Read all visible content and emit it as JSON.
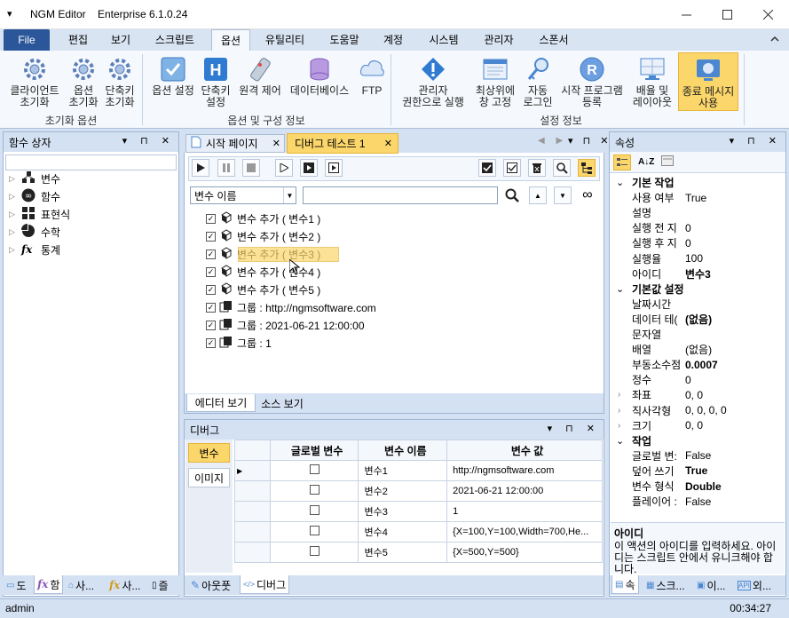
{
  "window": {
    "app_name": "NGM Editor",
    "edition": "Enterprise 6.1.0.24",
    "menu_glyph": "▾"
  },
  "menu": [
    "File",
    "편집",
    "보기",
    "스크립트",
    "옵션",
    "유틸리티",
    "도움말",
    "계정",
    "시스템",
    "관리자",
    "스폰서"
  ],
  "ribbon": {
    "group_reset": {
      "label": "초기화 옵션",
      "buttons": [
        "클라이언트\n초기화",
        "옵션\n초기화",
        "단축키\n초기화"
      ]
    },
    "group_options": {
      "label": "옵션 및 구성 정보",
      "buttons": [
        "옵션 설정",
        "단축키\n설정",
        "원격 제어",
        "데이터베이스",
        "FTP"
      ]
    },
    "group_settings": {
      "label": "설정 정보",
      "buttons": [
        "관리자\n권한으로 실행",
        "최상위에\n창 고정",
        "자동\n로그인",
        "시작 프로그램\n등록",
        "배율 및\n레이아웃",
        "종료 메시지\n사용"
      ]
    }
  },
  "func_box": {
    "title": "함수 상자",
    "items": [
      "변수",
      "함수",
      "표현식",
      "수학",
      "통계"
    ]
  },
  "editor": {
    "tabs": [
      "시작 페이지",
      "디버그 테스트 1"
    ],
    "combo_value": "변수 이름",
    "search_value": "",
    "rows": [
      {
        "text": "변수 추가 ( 변수1 )",
        "checked": true
      },
      {
        "text": "변수 추가 ( 변수2 )",
        "checked": true
      },
      {
        "text": "변수 추가 ( 변수3 )",
        "checked": true
      },
      {
        "text": "변수 추가 ( 변수4 )",
        "checked": true
      },
      {
        "text": "변수 추가 ( 변수5 )",
        "checked": true
      },
      {
        "text": "그룹 : http://ngmsoftware.com",
        "checked": true
      },
      {
        "text": "그룹 : 2021-06-21 12:00:00",
        "checked": true
      },
      {
        "text": "그룹 : 1",
        "checked": true
      }
    ],
    "bottom_tabs": [
      "에디터 보기",
      "소스 보기"
    ]
  },
  "debug": {
    "title": "디버그",
    "side_tabs": [
      "변수",
      "이미지"
    ],
    "columns": [
      "글로벌 변수",
      "변수 이름",
      "변수 값"
    ],
    "rows": [
      {
        "name": "변수1",
        "value": "http://ngmsoftware.com"
      },
      {
        "name": "변수2",
        "value": "2021-06-21 12:00:00"
      },
      {
        "name": "변수3",
        "value": "1"
      },
      {
        "name": "변수4",
        "value": "{X=100,Y=100,Width=700,He..."
      },
      {
        "name": "변수5",
        "value": "{X=500,Y=500}"
      }
    ],
    "bottom_tabs": [
      "아웃풋",
      "디버그"
    ]
  },
  "props": {
    "title": "속성",
    "rows": [
      {
        "cat": "기본 작업"
      },
      {
        "name": "사용 여부",
        "value": "True"
      },
      {
        "name": "설명",
        "value": ""
      },
      {
        "name": "실행 전 지",
        "value": "0"
      },
      {
        "name": "실행 후 지",
        "value": "0"
      },
      {
        "name": "실행율",
        "value": "100"
      },
      {
        "name": "아이디",
        "value": "변수3",
        "bold": true
      },
      {
        "cat": "기본값 설정"
      },
      {
        "name": "날짜시간",
        "value": ""
      },
      {
        "name": "데이터 테(",
        "value": "(없음)",
        "bold": true
      },
      {
        "name": "문자열",
        "value": ""
      },
      {
        "name": "배열",
        "value": "(없음)"
      },
      {
        "name": "부동소수점",
        "value": "0.0007",
        "bold": true
      },
      {
        "name": "정수",
        "value": "0"
      },
      {
        "name": "좌표",
        "value": "0, 0",
        "expand": true
      },
      {
        "name": "직사각형",
        "value": "0, 0, 0, 0",
        "expand": true
      },
      {
        "name": "크기",
        "value": "0, 0",
        "expand": true
      },
      {
        "cat": "작업"
      },
      {
        "name": "글로벌 변:",
        "value": "False"
      },
      {
        "name": "덮어 쓰기",
        "value": "True",
        "bold": true
      },
      {
        "name": "변수 형식",
        "value": "Double",
        "bold": true
      },
      {
        "name": "플레이어 :",
        "value": "False"
      }
    ],
    "desc_title": "아이디",
    "desc_text": "이 액션의 아이디를 입력하세요. 아이디는 스크립트 안에서 유니크해야 합니다.",
    "bottom_tabs": [
      "속",
      "스크...",
      "이...",
      "외..."
    ]
  },
  "left_bottom_tabs": [
    "도",
    "함",
    "사...",
    "사...",
    "즐"
  ],
  "status": {
    "user": "admin",
    "time": "00:34:27"
  }
}
